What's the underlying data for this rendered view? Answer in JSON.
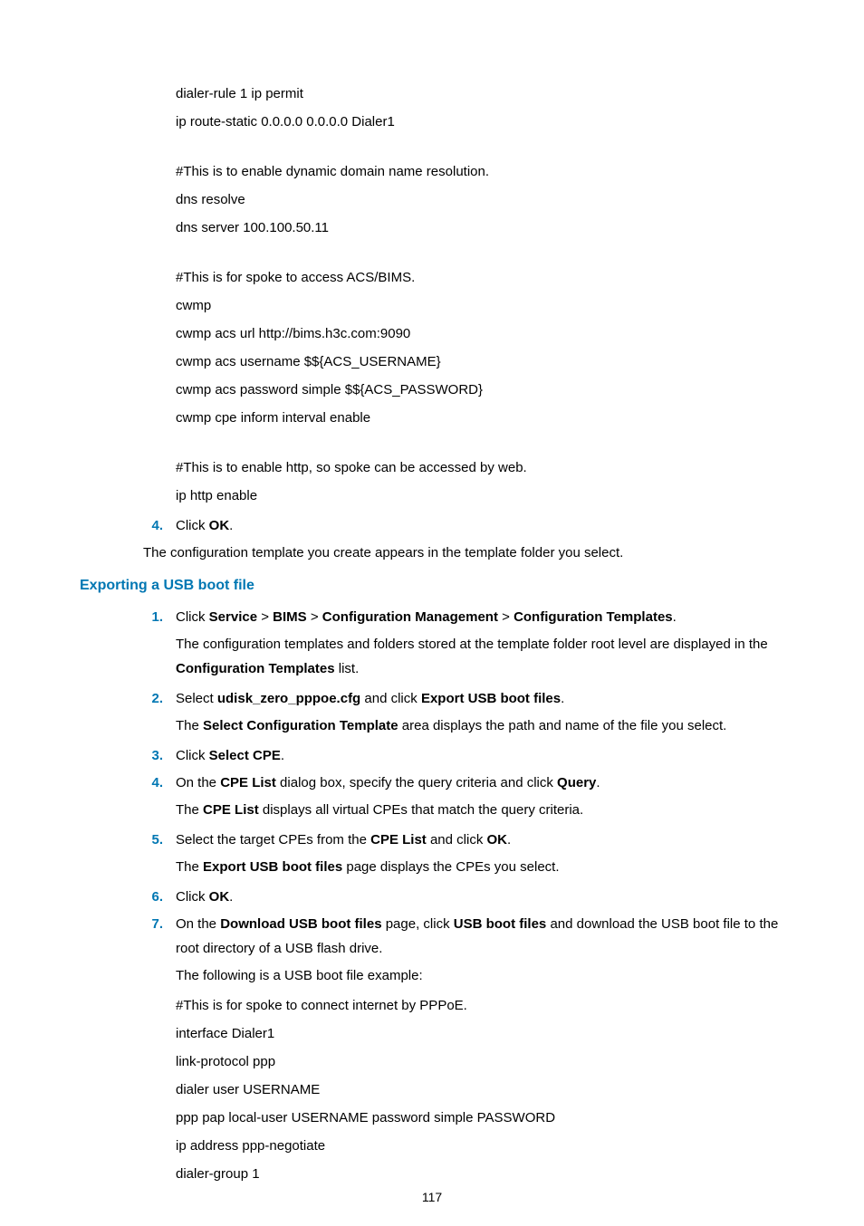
{
  "codeBlocksTop": [
    [
      "dialer-rule 1 ip permit",
      "ip route-static 0.0.0.0 0.0.0.0 Dialer1"
    ],
    [
      "#This is to enable dynamic domain name resolution.",
      "dns resolve",
      "dns server 100.100.50.11"
    ],
    [
      "#This is for spoke to access ACS/BIMS.",
      "cwmp",
      "cwmp acs url http://bims.h3c.com:9090",
      "cwmp acs username $${ACS_USERNAME}",
      "cwmp acs password simple $${ACS_PASSWORD}",
      "cwmp cpe inform interval enable"
    ],
    [
      "#This is to enable http, so spoke can be accessed by web.",
      "ip http enable"
    ]
  ],
  "step4": {
    "num": "4.",
    "pre": "Click ",
    "bold": "OK",
    "post": "."
  },
  "afterStep4": "The configuration template you create appears in the template folder you select.",
  "sectionHeading": "Exporting a USB boot file",
  "export": {
    "s1": {
      "num": "1.",
      "segs": [
        {
          "t": "Click "
        },
        {
          "t": "Service",
          "b": true
        },
        {
          "t": " > "
        },
        {
          "t": "BIMS",
          "b": true
        },
        {
          "t": " > "
        },
        {
          "t": "Configuration Management",
          "b": true
        },
        {
          "t": " > "
        },
        {
          "t": "Configuration Templates",
          "b": true
        },
        {
          "t": "."
        }
      ],
      "sub": [
        {
          "t": "The configuration templates and folders stored at the template folder root level are displayed in the "
        },
        {
          "t": "Configuration Templates",
          "b": true
        },
        {
          "t": " list."
        }
      ]
    },
    "s2": {
      "num": "2.",
      "segs": [
        {
          "t": "Select "
        },
        {
          "t": "udisk_zero_pppoe.cfg",
          "b": true
        },
        {
          "t": " and click "
        },
        {
          "t": "Export USB boot files",
          "b": true
        },
        {
          "t": "."
        }
      ],
      "sub": [
        {
          "t": "The "
        },
        {
          "t": "Select Configuration Template",
          "b": true
        },
        {
          "t": " area displays the path and name of the file you select."
        }
      ]
    },
    "s3": {
      "num": "3.",
      "segs": [
        {
          "t": "Click "
        },
        {
          "t": "Select CPE",
          "b": true
        },
        {
          "t": "."
        }
      ]
    },
    "s4": {
      "num": "4.",
      "segs": [
        {
          "t": "On the "
        },
        {
          "t": "CPE List",
          "b": true
        },
        {
          "t": " dialog box, specify the query criteria and click "
        },
        {
          "t": "Query",
          "b": true
        },
        {
          "t": "."
        }
      ],
      "sub": [
        {
          "t": "The "
        },
        {
          "t": "CPE List",
          "b": true
        },
        {
          "t": " displays all virtual CPEs that match the query criteria."
        }
      ]
    },
    "s5": {
      "num": "5.",
      "segs": [
        {
          "t": "Select the target CPEs from the "
        },
        {
          "t": "CPE List",
          "b": true
        },
        {
          "t": " and click "
        },
        {
          "t": "OK",
          "b": true
        },
        {
          "t": "."
        }
      ],
      "sub": [
        {
          "t": "The "
        },
        {
          "t": "Export USB boot files",
          "b": true
        },
        {
          "t": " page displays the CPEs you select."
        }
      ]
    },
    "s6": {
      "num": "6.",
      "segs": [
        {
          "t": "Click "
        },
        {
          "t": "OK",
          "b": true
        },
        {
          "t": "."
        }
      ]
    },
    "s7": {
      "num": "7.",
      "segs": [
        {
          "t": "On the "
        },
        {
          "t": "Download USB boot files",
          "b": true
        },
        {
          "t": " page, click "
        },
        {
          "t": "USB boot files",
          "b": true
        },
        {
          "t": " and download the USB boot file to the root directory of a USB flash drive."
        }
      ],
      "sub2": "The following is a USB boot file example:",
      "code": [
        "#This is for spoke to connect internet by PPPoE.",
        "interface Dialer1",
        "link-protocol ppp",
        "dialer user USERNAME",
        "ppp pap local-user USERNAME password simple PASSWORD",
        "ip address ppp-negotiate",
        "dialer-group 1"
      ]
    }
  },
  "pageNumber": "117"
}
